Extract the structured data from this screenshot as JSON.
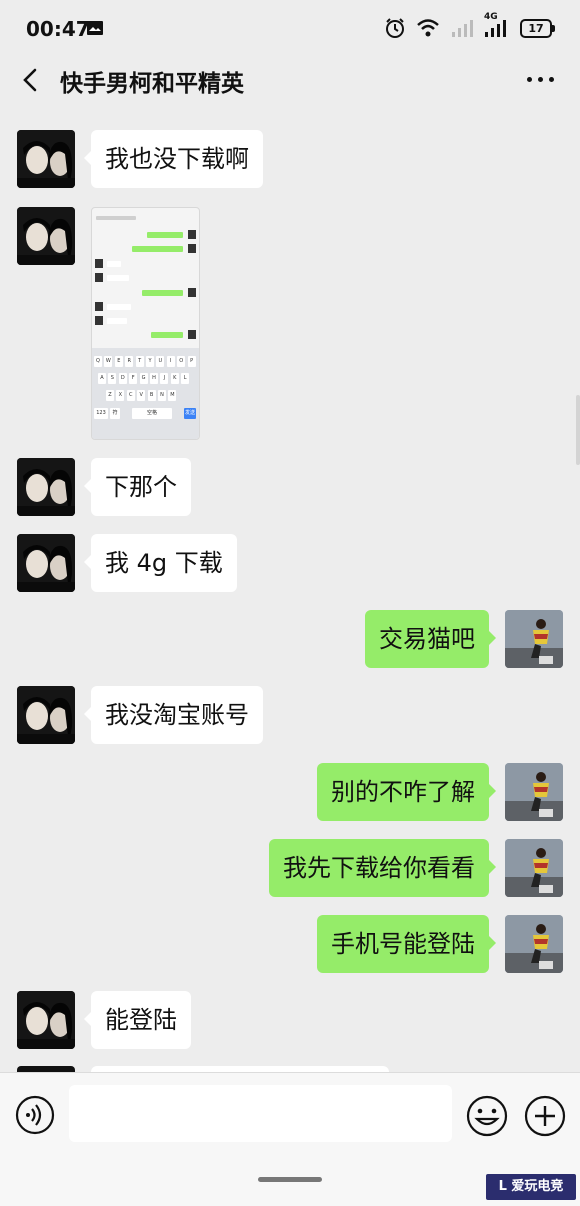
{
  "status_bar": {
    "time": "00:47",
    "network": "4G",
    "battery": "17",
    "icons": [
      "message-icon",
      "alarm-icon",
      "wifi-icon",
      "signal-icon"
    ]
  },
  "header": {
    "title": "快手男柯和平精英",
    "back_icon": "chevron-left-icon",
    "more_icon": "ellipsis-icon"
  },
  "messages": [
    {
      "side": "left",
      "type": "text",
      "text": "我也没下载啊"
    },
    {
      "side": "left",
      "type": "image",
      "text": ""
    },
    {
      "side": "left",
      "type": "text",
      "text": "下那个"
    },
    {
      "side": "left",
      "type": "text",
      "text": "我 4g 下载"
    },
    {
      "side": "right",
      "type": "text",
      "text": "交易猫吧"
    },
    {
      "side": "left",
      "type": "text",
      "text": "我没淘宝账号"
    },
    {
      "side": "right",
      "type": "text",
      "text": "别的不咋了解"
    },
    {
      "side": "right",
      "type": "text",
      "text": "我先下载给你看看"
    },
    {
      "side": "right",
      "type": "text",
      "text": "手机号能登陆"
    },
    {
      "side": "left",
      "type": "text",
      "text": "能登陆"
    }
  ],
  "embedded_screenshot": {
    "keyboard_rows": [
      [
        "Q",
        "W",
        "E",
        "R",
        "T",
        "Y",
        "U",
        "I",
        "O",
        "P"
      ],
      [
        "A",
        "S",
        "D",
        "F",
        "G",
        "H",
        "J",
        "K",
        "L"
      ],
      [
        "Z",
        "X",
        "C",
        "V",
        "B",
        "N",
        "M"
      ]
    ],
    "bottom_keys": [
      "123",
      "符",
      "空格",
      "发送"
    ]
  },
  "input_bar": {
    "placeholder": "",
    "voice_icon": "voice-icon",
    "emoji_icon": "emoji-icon",
    "plus_icon": "plus-icon"
  },
  "watermark": {
    "text": "L 爱玩电竞"
  },
  "colors": {
    "background": "#ededed",
    "bubble_sent": "#95ec69",
    "bubble_received": "#ffffff"
  }
}
